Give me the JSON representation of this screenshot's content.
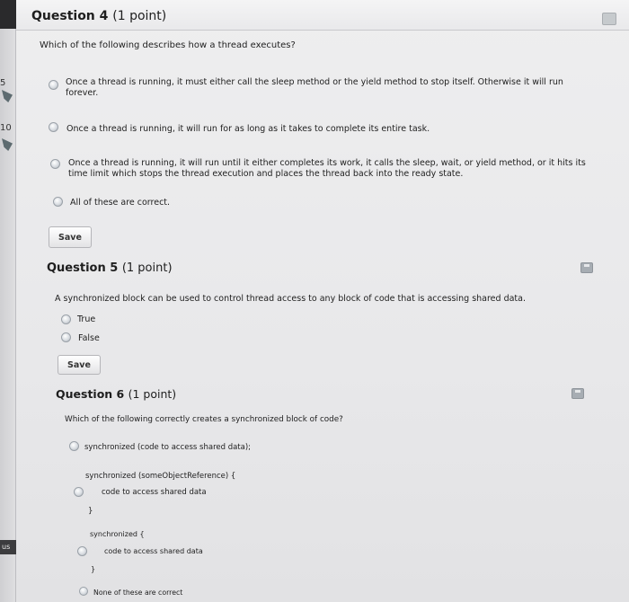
{
  "margin": {
    "labels": [
      "5",
      "10"
    ],
    "bottom_tab": "us"
  },
  "question4": {
    "title": "Question 4",
    "points": "(1 point)",
    "prompt": "Which of the following describes how a thread executes?",
    "options": [
      "Once a thread is running, it must either call the sleep method or the yield method to stop itself. Otherwise it will run forever.",
      "Once a thread is running, it will run for as long as it takes to complete its entire task.",
      "Once a thread is running, it will run until it either completes its work, it calls the sleep, wait, or yield method, or it hits its time limit which stops the thread execution and places the thread back into the ready state.",
      "All of these are correct."
    ],
    "save_label": "Save"
  },
  "question5": {
    "title": "Question 5",
    "points": "(1 point)",
    "prompt": "A synchronized block can be used to control thread access to any block of code that is accessing shared data.",
    "options": [
      "True",
      "False"
    ],
    "save_label": "Save"
  },
  "question6": {
    "title": "Question 6",
    "points": "(1 point)",
    "prompt": "Which of the following correctly creates a synchronized block of code?",
    "option1": "synchronized (code to access shared data);",
    "option2": {
      "line1": "synchronized (someObjectReference) {",
      "line2": "code to access shared data",
      "line3": "}"
    },
    "option3": {
      "line1": "synchronized {",
      "line2": "code to access shared data",
      "line3": "}"
    },
    "option4": "None of these are correct"
  }
}
